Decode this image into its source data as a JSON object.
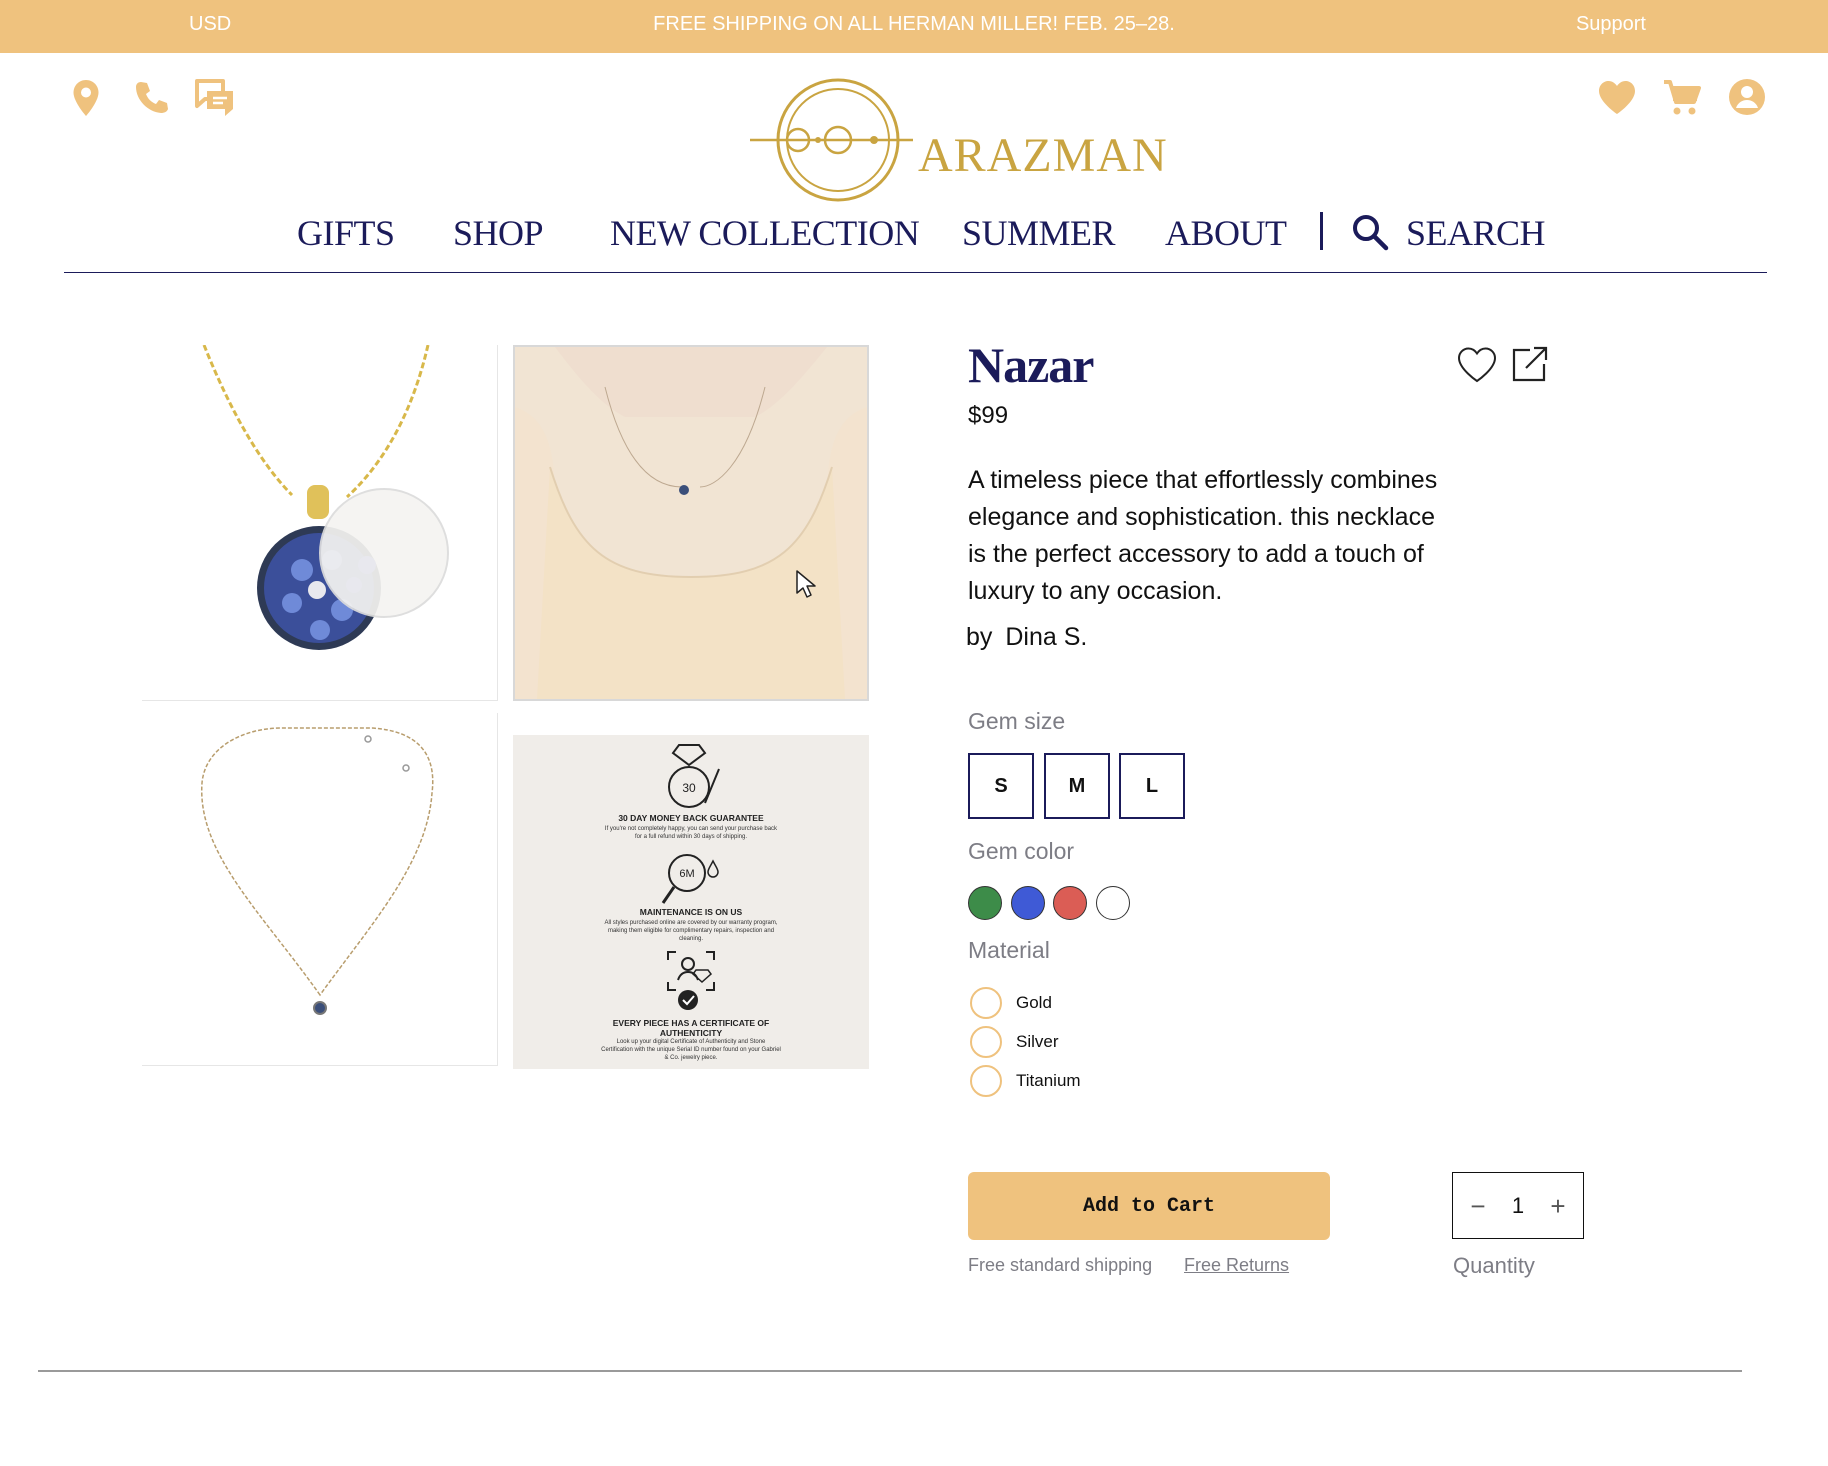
{
  "promo": {
    "currency": "USD",
    "message": "FREE SHIPPING ON ALL HERMAN MILLER! FEB. 25–28.",
    "support": "Support"
  },
  "brand": {
    "name": "ARAZMAN"
  },
  "nav": {
    "items": [
      "GIFTS",
      "SHOP",
      "NEW COLLECTION",
      "SUMMER",
      "ABOUT"
    ],
    "search_label": "SEARCH"
  },
  "gallery": {
    "guarantees": [
      {
        "badge": "30",
        "title": "30 DAY MONEY BACK GUARANTEE",
        "body": "If you're not completely happy, you can send your purchase back for a full refund within 30 days of shipping."
      },
      {
        "badge": "6M",
        "title": "MAINTENANCE IS ON US",
        "body": "All styles purchased online are covered by our warranty program, making them eligible for complimentary repairs, inspection and cleaning."
      },
      {
        "badge": "",
        "title": "EVERY PIECE HAS A CERTIFICATE OF AUTHENTICITY",
        "body": "Look up your digital Certificate of Authenticity and Stone Certification with the unique Serial ID number found on your Gabriel & Co. jewelry piece."
      }
    ]
  },
  "product": {
    "title": "Nazar",
    "price": "$99",
    "description": "A timeless piece that effortlessly combines elegance and sophistication. this necklace is the perfect accessory to add a touch of luxury to any occasion.",
    "by_label": "by",
    "designer": "Dina S."
  },
  "options": {
    "gem_size_label": "Gem size",
    "sizes": [
      "S",
      "M",
      "L"
    ],
    "gem_color_label": "Gem color",
    "colors": [
      "#3d8c49",
      "#3f5ad6",
      "#db5d55",
      "#ffffff"
    ],
    "material_label": "Material",
    "materials": [
      "Gold",
      "Silver",
      "Titanium"
    ]
  },
  "cart": {
    "add_label": "Add to Cart",
    "shipping_note": "Free standard shipping",
    "returns_link": "Free Returns",
    "quantity_value": "1",
    "quantity_label": "Quantity",
    "minus": "−",
    "plus": "+"
  },
  "theme": {
    "accent": "#efc27e",
    "navy": "#1b1b5a",
    "gold": "#c9a441"
  }
}
